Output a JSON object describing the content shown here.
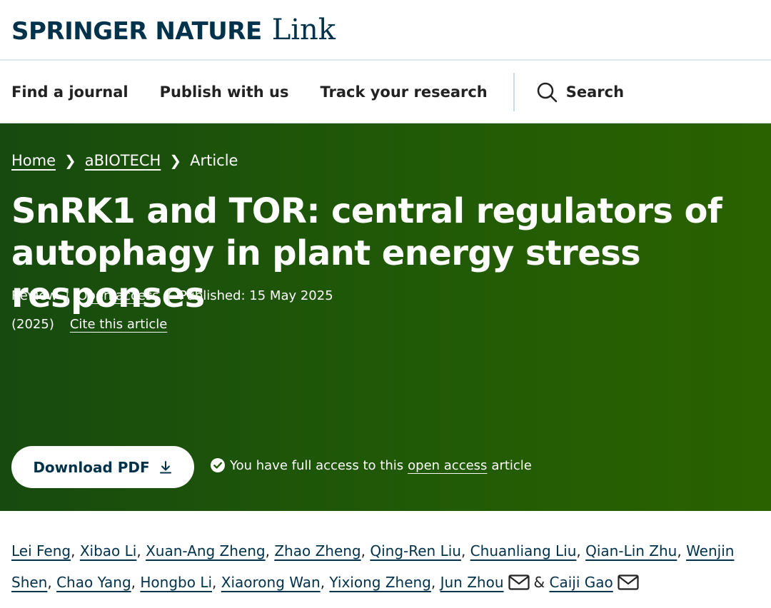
{
  "header": {
    "brand": "SPRINGER NATURE",
    "brand_suffix": "Link"
  },
  "nav": {
    "items": [
      "Find a journal",
      "Publish with us",
      "Track your research"
    ],
    "search_label": "Search"
  },
  "breadcrumb": {
    "home": "Home",
    "journal": "aBIOTECH",
    "current": "Article"
  },
  "article": {
    "title": "SnRK1 and TOR: central regulators of autophagy in plant energy stress responses",
    "type": "Review",
    "access": "Open access",
    "published": "Published: 15 May 2025",
    "year": "(2025)",
    "cite": "Cite this article"
  },
  "download": {
    "label": "Download PDF"
  },
  "access_note": {
    "prefix": "You have full access to this",
    "link": "open access",
    "suffix": "article"
  },
  "authors": {
    "list": [
      "Lei Feng",
      "Xibao Li",
      "Xuan-Ang Zheng",
      "Zhao Zheng",
      "Qing-Ren Liu",
      "Chuanliang Liu",
      "Qian-Lin Zhu",
      "Wenjin Shen",
      "Chao Yang",
      "Hongbo Li",
      "Xiaorong Wan",
      "Yixiong Zheng",
      "Jun Zhou",
      "Caiji Gao"
    ],
    "conjunction": "&"
  },
  "colors": {
    "brand": "#01324b",
    "hero_green": "#215a06",
    "white": "#ffffff"
  }
}
